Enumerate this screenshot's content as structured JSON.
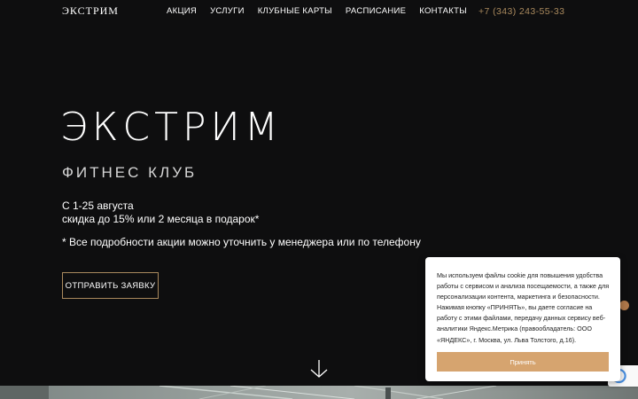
{
  "header": {
    "logo": "ЭКСТРИМ",
    "nav": [
      "АКЦИЯ",
      "УСЛУГИ",
      "КЛУБНЫЕ КАРТЫ",
      "РАСПИСАНИЕ",
      "КОНТАКТЫ"
    ],
    "phone": "+7 (343) 243-55-33"
  },
  "hero": {
    "title": "ЭКСТРИМ",
    "subtitle": "ФИТНЕС КЛУБ",
    "promo_line1": "С 1-25 августа",
    "promo_line2": "скидка до 15% или 2 месяца в подарок*",
    "note": "* Все подробности акции можно уточнить у менеджера или по телефону",
    "cta": "ОТПРАВИТЬ ЗАЯВКУ"
  },
  "cookie": {
    "text": "Мы используем файлы cookie для повышения удобства работы с сервисом и анализа посещаемости, а также для персонализации контента, маркетинга и безопасности. Нажимая кнопку «ПРИНЯТЬ», вы даете согласие на работу с этими файлами, передачу данных сервису веб-аналитики Яндекс.Метрика (правообладатель: ООО «ЯНДЕКС», г. Москва, ул. Льва Толстого, д.16).",
    "accept": "Принять"
  },
  "colors": {
    "background": "#0e0e0f",
    "accent": "#a9895d",
    "cookie_button": "#d6a46f"
  },
  "icons": {
    "scroll": "arrow-down-icon",
    "side": "dot-icon",
    "recaptcha": "recaptcha-icon"
  }
}
